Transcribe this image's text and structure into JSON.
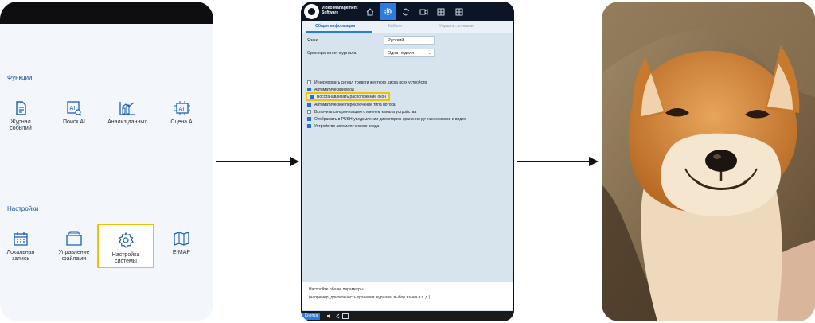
{
  "left": {
    "functions_title": "Функции",
    "functions": [
      {
        "label": "Журнал\nсобытий",
        "icon": "event-log-icon"
      },
      {
        "label": "Поиск AI",
        "icon": "ai-search-icon"
      },
      {
        "label": "Анализ данных",
        "icon": "data-analysis-icon"
      },
      {
        "label": "Сцена AI",
        "icon": "ai-scene-icon"
      }
    ],
    "settings_title": "Настройки",
    "settings": [
      {
        "label": "Локальная\nзапись",
        "icon": "calendar-icon"
      },
      {
        "label": "Управление\nфайлами",
        "icon": "folder-icon"
      },
      {
        "label": "Настройка\nсистемы",
        "icon": "gear-icon"
      },
      {
        "label": "E-MAP",
        "icon": "map-icon"
      }
    ],
    "accent": "#1a4f9a",
    "highlight": "#f2c200"
  },
  "app": {
    "title": "Video Management\nSoftware",
    "tabs": [
      "Общая информация",
      "Кабели",
      "Управле...ктивами"
    ],
    "language_label": "Язык:",
    "language_value": "Русский",
    "log_label": "Срок хранения журнала:",
    "log_value": "Одна неделя",
    "options": [
      {
        "label": "Игнорировать сигнал тревоги жесткого диска всех устройств",
        "checked": false
      },
      {
        "label": "Автоматический вход",
        "checked": true
      },
      {
        "label": "Восстанавливать расположение окон",
        "checked": true,
        "highlight": true
      },
      {
        "label": "Автоматическое переключение типа потока",
        "checked": true
      },
      {
        "label": "Включить синхронизацию с именем канала устройства",
        "checked": false
      },
      {
        "label": "Отображать в PUSH-уведомлении директорию хранения ручных снимков и видео",
        "checked": true
      },
      {
        "label": "Устройство автоматического входа",
        "checked": true
      }
    ],
    "info_line1": "Настройте общие параметры.",
    "info_line2": "(например, длительность хранения журнала, выбор языка и т. д.)",
    "status_chip": "Кнопка",
    "accent": "#2b7be0"
  }
}
